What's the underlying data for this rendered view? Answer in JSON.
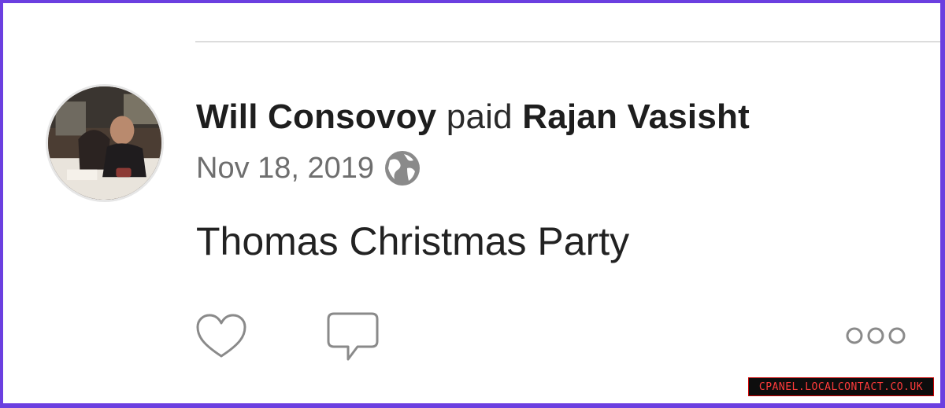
{
  "feed_item": {
    "payer": "Will Consovoy",
    "verb": "paid",
    "payee": "Rajan Vasisht",
    "date": "Nov 18, 2019",
    "visibility_icon": "globe-icon",
    "note": "Thomas Christmas Party",
    "actions": {
      "like_icon": "heart-icon",
      "comment_icon": "comment-icon",
      "more_icon": "more-options-icon"
    }
  },
  "watermark": "CPANEL.LOCALCONTACT.CO.UK",
  "colors": {
    "frame_border": "#6b3fe0",
    "name_text": "#1e1e1e",
    "date_text": "#6e6e6e",
    "icon_gray": "#8a8a8a"
  }
}
